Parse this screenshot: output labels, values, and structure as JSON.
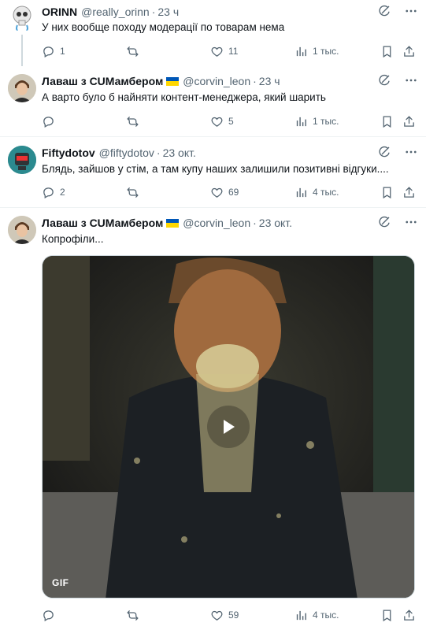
{
  "tweets": [
    {
      "name": "ORINN",
      "handle": "@really_orinn",
      "time": "23 ч",
      "text": "У них вообще походу модерації по товарам нема",
      "replies": "1",
      "retweets": "",
      "likes": "11",
      "views": "1 тыс.",
      "verified_flag": false
    },
    {
      "name": "Лаваш з СUМамбером",
      "handle": "@corvin_leon",
      "time": "23 ч",
      "text": "А варто було б найняти контент-менеджера, який шарить",
      "replies": "",
      "retweets": "",
      "likes": "5",
      "views": "1 тыс.",
      "verified_flag": true
    },
    {
      "name": "Fiftydotov",
      "handle": "@fiftydotov",
      "time": "23 окт.",
      "text": "Блядь, зайшов у стім, а там купу наших залишили позитивні відгуки....",
      "replies": "2",
      "retweets": "",
      "likes": "69",
      "views": "4 тыс.",
      "verified_flag": false
    },
    {
      "name": "Лаваш з СUМамбером",
      "handle": "@corvin_leon",
      "time": "23 окт.",
      "text": "Копрофіли...",
      "replies": "",
      "retweets": "",
      "likes": "59",
      "views": "4 тыс.",
      "verified_flag": true,
      "media_badge": "GIF"
    }
  ],
  "colors": {
    "text": "#0f1419",
    "secondary": "#536471",
    "divider": "#eff3f4",
    "flag_blue": "#0057b7",
    "flag_yellow": "#ffd700"
  },
  "icons": [
    "reply-icon",
    "retweet-icon",
    "like-icon",
    "views-icon",
    "bookmark-icon",
    "share-icon",
    "grok-icon",
    "more-icon",
    "play-icon"
  ]
}
